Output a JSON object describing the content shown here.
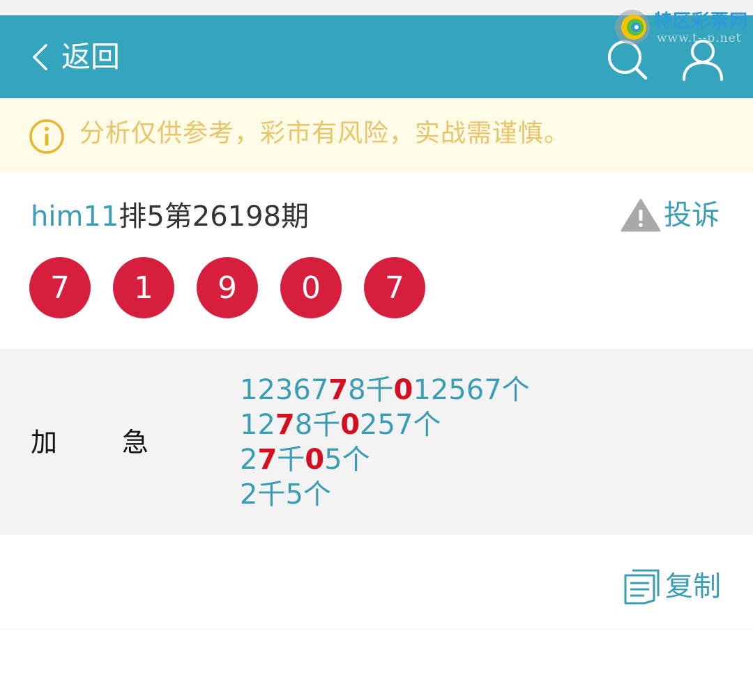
{
  "header": {
    "back_label": "返回",
    "icons": {
      "back": "chevron-left-icon",
      "search": "search-icon",
      "user": "user-icon"
    },
    "background": "#35a5bd"
  },
  "watermark": {
    "title": "特区彩票网",
    "url": "www.t--p.net"
  },
  "notice": {
    "text": "分析仅供参考，彩市有风险，实战需谨慎。",
    "icon": "info-circle-icon",
    "background": "#fffbe7",
    "color": "#e8c46a"
  },
  "post": {
    "username": "him11",
    "title_rest": "排5第26198期",
    "complain_label": "投诉",
    "complain_icon": "warning-triangle-icon"
  },
  "draw": {
    "numbers": [
      "7",
      "1",
      "9",
      "0",
      "7"
    ],
    "ball_color": "#d81e3d"
  },
  "prediction": {
    "label_1": "加",
    "label_2": "急",
    "lines": [
      [
        {
          "t": "12367",
          "hit": false
        },
        {
          "t": "7",
          "hit": true
        },
        {
          "t": "8千",
          "hit": false
        },
        {
          "t": "0",
          "hit": true
        },
        {
          "t": "12567个",
          "hit": false
        }
      ],
      [
        {
          "t": "12",
          "hit": false
        },
        {
          "t": "7",
          "hit": true
        },
        {
          "t": "8千",
          "hit": false
        },
        {
          "t": "0",
          "hit": true
        },
        {
          "t": "257个",
          "hit": false
        }
      ],
      [
        {
          "t": "2",
          "hit": false
        },
        {
          "t": "7",
          "hit": true
        },
        {
          "t": "千",
          "hit": false
        },
        {
          "t": "0",
          "hit": true
        },
        {
          "t": "5个",
          "hit": false
        }
      ],
      [
        {
          "t": "2千5个",
          "hit": false
        }
      ]
    ],
    "hit_color": "#d50f1f",
    "text_color": "#3b9db3"
  },
  "actions": {
    "copy_label": "复制",
    "copy_icon": "copy-document-icon"
  }
}
